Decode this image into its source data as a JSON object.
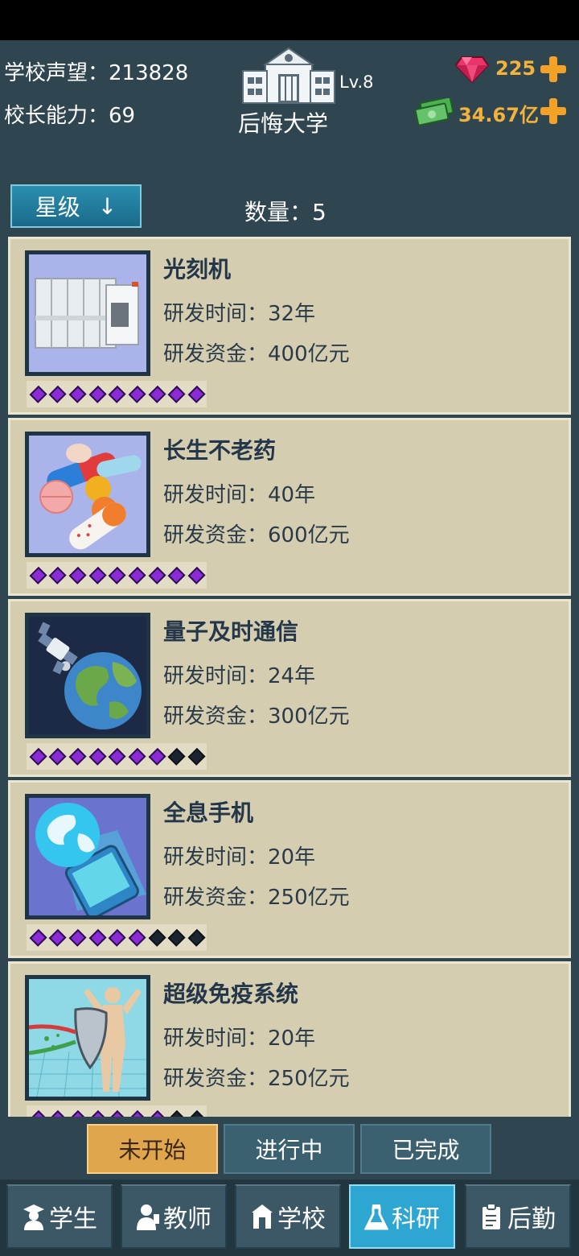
{
  "header": {
    "reputation_label": "学校声望：",
    "reputation_value": "213828",
    "ability_label": "校长能力：",
    "ability_value": "69",
    "level": "Lv.8",
    "school_name": "后悔大学",
    "gems": "225",
    "money": "34.67亿",
    "accent_color": "#f3b23b"
  },
  "toolbar": {
    "sort_label": "星级",
    "sort_arrow": "↓",
    "count_label": "数量：",
    "count_value": "5"
  },
  "research": [
    {
      "name": "光刻机",
      "time_label": "研发时间：",
      "time": "32年",
      "fund_label": "研发资金：",
      "fund": "400亿元",
      "stars": 9,
      "max_stars": 9,
      "icon": "lithography-machine-icon"
    },
    {
      "name": "长生不老药",
      "time_label": "研发时间：",
      "time": "40年",
      "fund_label": "研发资金：",
      "fund": "600亿元",
      "stars": 9,
      "max_stars": 9,
      "icon": "pills-icon"
    },
    {
      "name": "量子及时通信",
      "time_label": "研发时间：",
      "time": "24年",
      "fund_label": "研发资金：",
      "fund": "300亿元",
      "stars": 7,
      "max_stars": 9,
      "icon": "satellite-earth-icon"
    },
    {
      "name": "全息手机",
      "time_label": "研发时间：",
      "time": "20年",
      "fund_label": "研发资金：",
      "fund": "250亿元",
      "stars": 6,
      "max_stars": 9,
      "icon": "holographic-phone-icon"
    },
    {
      "name": "超级免疫系统",
      "time_label": "研发时间：",
      "time": "20年",
      "fund_label": "研发资金：",
      "fund": "250亿元",
      "stars": 7,
      "max_stars": 9,
      "icon": "immune-shield-icon"
    }
  ],
  "filter_tabs": [
    {
      "label": "未开始",
      "active": true
    },
    {
      "label": "进行中",
      "active": false
    },
    {
      "label": "已完成",
      "active": false
    }
  ],
  "bottom_nav": [
    {
      "label": "学生",
      "icon": "student-icon",
      "active": false
    },
    {
      "label": "教师",
      "icon": "teacher-icon",
      "active": false
    },
    {
      "label": "学校",
      "icon": "school-icon",
      "active": false
    },
    {
      "label": "科研",
      "icon": "flask-icon",
      "active": true
    },
    {
      "label": "后勤",
      "icon": "clipboard-icon",
      "active": false
    }
  ]
}
